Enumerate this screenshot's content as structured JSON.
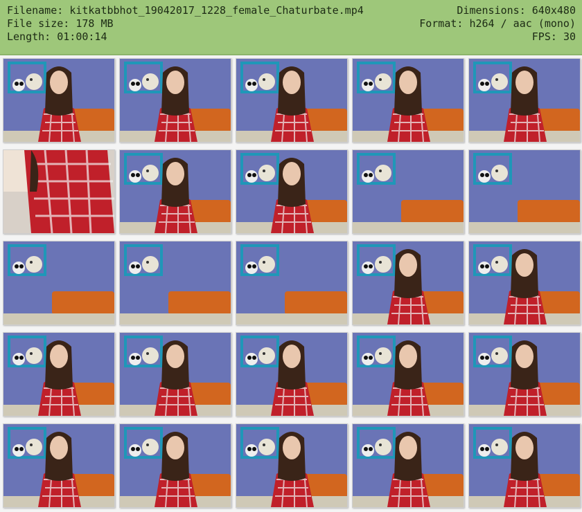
{
  "header": {
    "filename_label": "Filename:",
    "filename": "kitkatbbhot_19042017_1228_female_Chaturbate.mp4",
    "filesize_label": "File size:",
    "filesize": "178 MB",
    "length_label": "Length:",
    "length": "01:00:14",
    "dimensions_label": "Dimensions:",
    "dimensions": "640x480",
    "format_label": "Format:",
    "format": "h264 / aac (mono)",
    "fps_label": "FPS:",
    "fps": "30"
  },
  "colors": {
    "header_bg": "#9ec77a",
    "wall": "#6a74b6",
    "shelf": "#1f97b8",
    "cushion": "#d2661f",
    "shirt": "#c0202a",
    "hair": "#3a2418"
  },
  "thumbnails": [
    {
      "scene": "person-center"
    },
    {
      "scene": "person-center"
    },
    {
      "scene": "person-center"
    },
    {
      "scene": "person-center"
    },
    {
      "scene": "person-center"
    },
    {
      "scene": "close-up-shirt"
    },
    {
      "scene": "person-center"
    },
    {
      "scene": "person-center"
    },
    {
      "scene": "empty-room"
    },
    {
      "scene": "empty-room"
    },
    {
      "scene": "empty-room"
    },
    {
      "scene": "empty-room"
    },
    {
      "scene": "empty-room"
    },
    {
      "scene": "person-center"
    },
    {
      "scene": "person-center"
    },
    {
      "scene": "person-center"
    },
    {
      "scene": "person-center"
    },
    {
      "scene": "person-center"
    },
    {
      "scene": "person-center"
    },
    {
      "scene": "person-center"
    },
    {
      "scene": "person-center"
    },
    {
      "scene": "person-center"
    },
    {
      "scene": "person-center"
    },
    {
      "scene": "person-center"
    },
    {
      "scene": "person-center"
    }
  ]
}
